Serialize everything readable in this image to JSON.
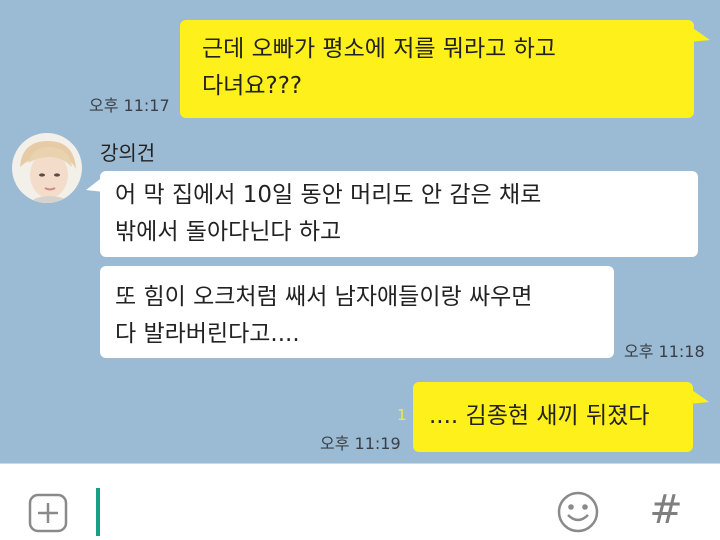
{
  "messages": {
    "m1": {
      "text": "근데 오빠가 평소에 저를 뭐라고 하고\n다녀요???",
      "time": "오후 11:17"
    },
    "sender_name": "강의건",
    "m2": {
      "text": "어 막 집에서 10일 동안 머리도 안 감은 채로\n밖에서 돌아다닌다 하고"
    },
    "m3": {
      "text": "또 힘이 오크처럼 쌔서 남자애들이랑 싸우면\n다 발라버린다고....",
      "time": "오후 11:18"
    },
    "m4": {
      "text": ".... 김종현 새끼 뒤졌다",
      "time": "오후 11:19",
      "unread": "1"
    }
  },
  "colors": {
    "background": "#9bbbd4",
    "my_bubble": "#fef01b",
    "their_bubble": "#ffffff",
    "cursor": "#17a085"
  },
  "input_bar": {
    "plus_icon": "plus-square-icon",
    "emoji_icon": "smiley-icon",
    "hash_label": "#"
  }
}
